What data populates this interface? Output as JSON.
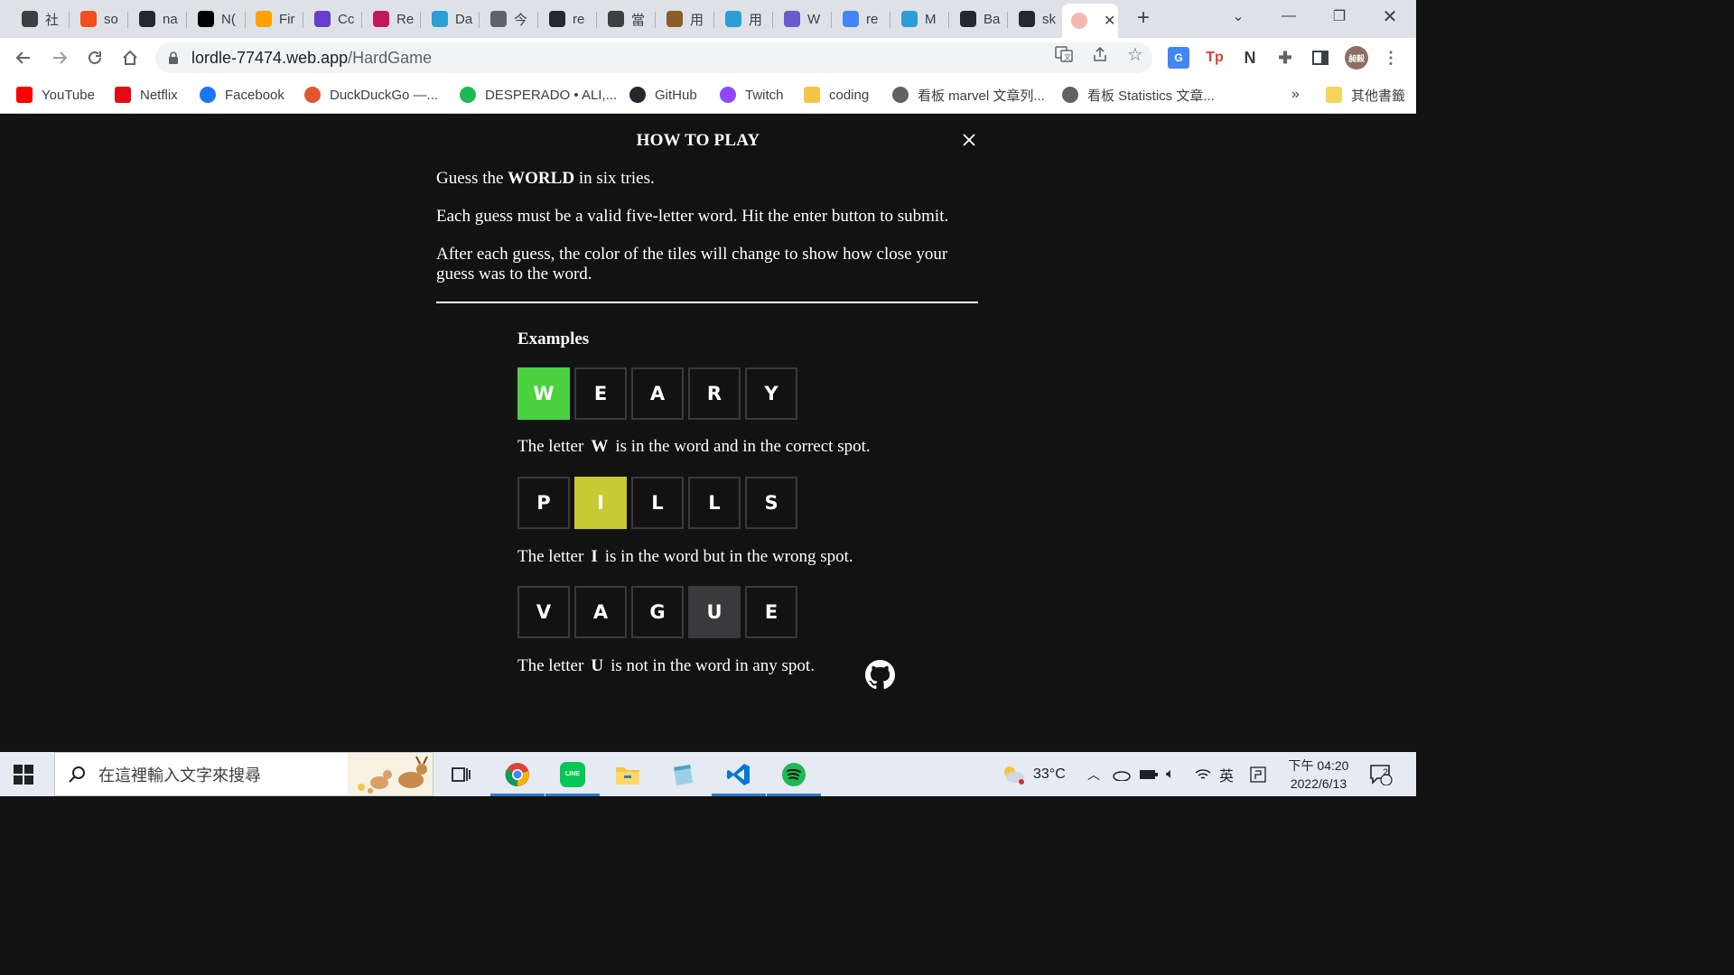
{
  "browser": {
    "tabs": [
      {
        "label": "社",
        "icon": "rocket-icon",
        "color": "#3c4043"
      },
      {
        "label": "so",
        "icon": "figma-icon",
        "color": "#f24e1e"
      },
      {
        "label": "na",
        "icon": "github-icon",
        "color": "#24292f"
      },
      {
        "label": "N(",
        "icon": "notion-icon",
        "color": "#000000"
      },
      {
        "label": "Fir",
        "icon": "firebase-icon",
        "color": "#ffa000"
      },
      {
        "label": "Cc",
        "icon": "codecademy-icon",
        "color": "#6a3cc9"
      },
      {
        "label": "Re",
        "icon": "dots-icon",
        "color": "#c2185b"
      },
      {
        "label": "Da",
        "icon": "map-icon",
        "color": "#2a9fd6"
      },
      {
        "label": "今",
        "icon": "globe-icon",
        "color": "#5f6368"
      },
      {
        "label": "re",
        "icon": "github-icon",
        "color": "#24292f"
      },
      {
        "label": "當",
        "icon": "tb-icon",
        "color": "#3c4043"
      },
      {
        "label": "用",
        "icon": "image-icon",
        "color": "#8d5b2c"
      },
      {
        "label": "用",
        "icon": "map-icon",
        "color": "#2a9fd6"
      },
      {
        "label": "W",
        "icon": "swirl-icon",
        "color": "#6a5acd"
      },
      {
        "label": "re",
        "icon": "google-icon",
        "color": "#4285f4"
      },
      {
        "label": "M",
        "icon": "map-icon",
        "color": "#2a9fd6"
      },
      {
        "label": "Ba",
        "icon": "github-icon",
        "color": "#24292f"
      },
      {
        "label": "sk",
        "icon": "github-icon",
        "color": "#24292f"
      }
    ],
    "active_tab": {
      "icon": "brain-icon",
      "color": "#e57373"
    },
    "url_host": "lordle-77474.web.app",
    "url_path": "/HardGame",
    "profile_initials": "昶毅",
    "bookmarks": [
      {
        "label": "YouTube",
        "icon": "youtube-icon",
        "color": "#ff0000"
      },
      {
        "label": "Netflix",
        "icon": "netflix-icon",
        "color": "#e50914"
      },
      {
        "label": "Facebook",
        "icon": "facebook-icon",
        "color": "#1877f2"
      },
      {
        "label": "DuckDuckGo —...",
        "icon": "duckduckgo-icon",
        "color": "#de5833"
      },
      {
        "label": "DESPERADO • ALI,...",
        "icon": "spotify-icon",
        "color": "#1db954"
      },
      {
        "label": "GitHub",
        "icon": "github-icon",
        "color": "#24292f"
      },
      {
        "label": "Twitch",
        "icon": "twitch-icon",
        "color": "#9146ff"
      },
      {
        "label": "coding",
        "icon": "folder-icon",
        "color": "#f4c542"
      },
      {
        "label": "看板 marvel 文章列...",
        "icon": "globe-icon",
        "color": "#5f6368"
      },
      {
        "label": "看板 Statistics 文章...",
        "icon": "globe-icon",
        "color": "#5f6368"
      }
    ],
    "bookmarks_overflow": "»",
    "other_bookmarks": "其他書籤"
  },
  "modal": {
    "title": "HOW TO PLAY",
    "intro_pre": "Guess the ",
    "intro_word": "WORLD",
    "intro_post": " in six tries.",
    "rule_1": "Each guess must be a valid five-letter word. Hit the enter button to submit.",
    "rule_2": "After each guess, the color of the tiles will change to show how close your guess was to the word.",
    "examples_heading": "Examples",
    "examples": [
      {
        "word": [
          "W",
          "E",
          "A",
          "R",
          "Y"
        ],
        "states": [
          "correct",
          "empty",
          "empty",
          "empty",
          "empty"
        ],
        "text_pre": "The letter",
        "letter": "W",
        "text_post": "is in the word and in the correct spot."
      },
      {
        "word": [
          "P",
          "I",
          "L",
          "L",
          "S"
        ],
        "states": [
          "empty",
          "present",
          "empty",
          "empty",
          "empty"
        ],
        "text_pre": "The letter",
        "letter": "I",
        "text_post": "is in the word but in the wrong spot."
      },
      {
        "word": [
          "V",
          "A",
          "G",
          "U",
          "E"
        ],
        "states": [
          "empty",
          "empty",
          "empty",
          "absent",
          "empty"
        ],
        "text_pre": "The letter",
        "letter": "U",
        "text_post": "is not in the word in any spot."
      }
    ],
    "colors": {
      "correct": "#4cd140",
      "present": "#c9c934",
      "absent": "#3a3a3c",
      "background": "#121212"
    }
  },
  "taskbar": {
    "search_placeholder": "在這裡輸入文字來搜尋",
    "apps": [
      "chrome-icon",
      "line-icon",
      "file-explorer-icon",
      "notes-icon",
      "vscode-icon",
      "spotify-icon"
    ],
    "weather": "33°C",
    "ime": "英",
    "time": "下午 04:20",
    "date": "2022/6/13",
    "notifications": "2"
  }
}
